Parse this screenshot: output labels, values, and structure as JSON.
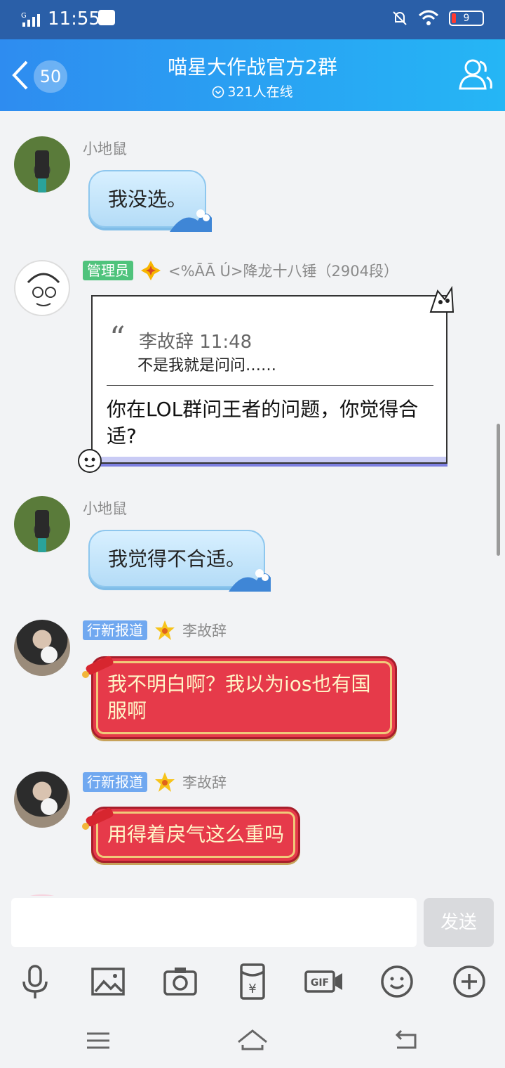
{
  "status_bar": {
    "time": "11:55",
    "battery_level": "9",
    "battery_color": "#ff3b30"
  },
  "header": {
    "unread_count": "50",
    "group_name": "喵星大作战官方2群",
    "online_text": "321人在线",
    "gradient_start": "#2e8cf0",
    "gradient_end": "#25b6f5"
  },
  "messages": [
    {
      "sender": "小地鼠",
      "text": "我没选。",
      "bubble": "blue-wave"
    },
    {
      "sender": "<%ĀĀ Ú>降龙十八锤（2904段）",
      "badge": "管理员",
      "badge_color": "#4fc37c",
      "bubble": "comic-card",
      "quote": {
        "author_time": "李故辞 11:48",
        "text": "不是我就是问问……"
      },
      "text": "你在LOL群问王者的问题，你觉得合适?"
    },
    {
      "sender": "小地鼠",
      "text": "我觉得不合适。",
      "bubble": "blue-wave"
    },
    {
      "sender": "李故辞",
      "badge": "行新报道",
      "badge_color": "#70a8f0",
      "text": "我不明白啊？我以为ios也有国服啊",
      "bubble": "red-festive"
    },
    {
      "sender": "李故辞",
      "badge": "行新报道",
      "badge_color": "#70a8f0",
      "text": "用得着戾气这么重吗",
      "bubble": "red-festive"
    }
  ],
  "input": {
    "value": "",
    "send_label": "发送"
  },
  "toolbar": [
    "mic-icon",
    "image-icon",
    "camera-icon",
    "red-packet-icon",
    "gif-icon",
    "emoji-icon",
    "plus-icon"
  ],
  "navigation": [
    "menu-icon",
    "home-icon",
    "back-icon"
  ]
}
